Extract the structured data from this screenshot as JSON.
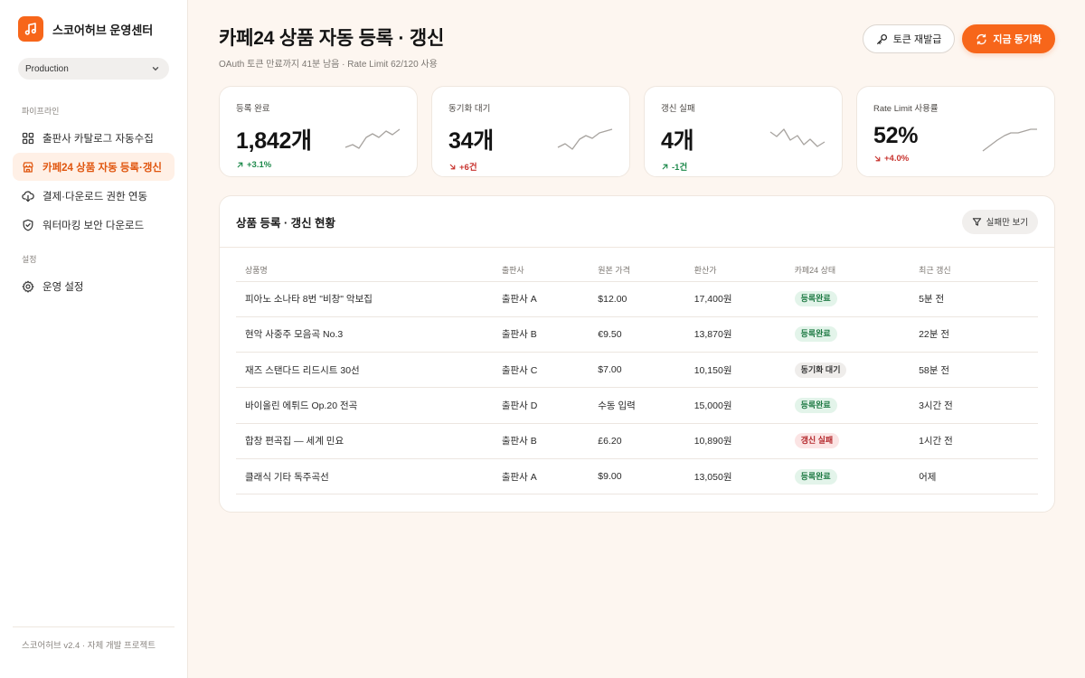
{
  "sidebar": {
    "brand": "스코어허브 운영센터",
    "env": "Production",
    "section_pipeline": "파이프라인",
    "items": [
      {
        "label": "출판사 카탈로그 자동수집",
        "icon": "grid-icon"
      },
      {
        "label": "카페24 상품 자동 등록·갱신",
        "icon": "store-icon",
        "active": true
      },
      {
        "label": "결제·다운로드 권한 연동",
        "icon": "cloud-download-icon"
      },
      {
        "label": "워터마킹 보안 다운로드",
        "icon": "shield-icon"
      }
    ],
    "section_settings": "설정",
    "settings_item": "운영 설정",
    "footer": "스코어허브 v2.4 · 자체 개발 프로젝트"
  },
  "header": {
    "title": "카페24 상품 자동 등록 · 갱신",
    "subtitle": "OAuth 토큰 만료까지 41분 남음 · Rate Limit 62/120 사용",
    "reissue_label": "토큰 재발급",
    "sync_label": "지금 동기화"
  },
  "kpis": [
    {
      "label": "등록 완료",
      "value": "1,842개",
      "delta": "+3.1%",
      "trend": "up",
      "tone": "good"
    },
    {
      "label": "동기화 대기",
      "value": "34개",
      "delta": "+6건",
      "trend": "down",
      "tone": "bad"
    },
    {
      "label": "갱신 실패",
      "value": "4개",
      "delta": "-1건",
      "trend": "up",
      "tone": "good"
    },
    {
      "label": "Rate Limit 사용률",
      "value": "52%",
      "delta": "+4.0%",
      "trend": "down",
      "tone": "bad"
    }
  ],
  "table": {
    "title": "상품 등록 · 갱신 현황",
    "filter_label": "실패만 보기",
    "columns": [
      "상품명",
      "출판사",
      "원본 가격",
      "환산가",
      "카페24 상태",
      "최근 갱신"
    ],
    "rows": [
      {
        "name": "피아노 소나타 8번 \"비창\" 악보집",
        "publisher": "출판사 A",
        "price": "$12.00",
        "converted": "17,400원",
        "status": "등록완료",
        "status_type": "ok",
        "updated": "5분 전"
      },
      {
        "name": "현악 사중주 모음곡 No.3",
        "publisher": "출판사 B",
        "price": "€9.50",
        "converted": "13,870원",
        "status": "등록완료",
        "status_type": "ok",
        "updated": "22분 전"
      },
      {
        "name": "재즈 스탠다드 리드시트 30선",
        "publisher": "출판사 C",
        "price": "$7.00",
        "converted": "10,150원",
        "status": "동기화 대기",
        "status_type": "wait",
        "updated": "58분 전"
      },
      {
        "name": "바이올린 에튀드 Op.20 전곡",
        "publisher": "출판사 D",
        "price": "수동 입력",
        "converted": "15,000원",
        "status": "등록완료",
        "status_type": "ok",
        "updated": "3시간 전"
      },
      {
        "name": "합창 편곡집 — 세계 민요",
        "publisher": "출판사 B",
        "price": "£6.20",
        "converted": "10,890원",
        "status": "갱신 실패",
        "status_type": "fail",
        "updated": "1시간 전"
      },
      {
        "name": "클래식 기타 독주곡선",
        "publisher": "출판사 A",
        "price": "$9.00",
        "converted": "13,050원",
        "status": "등록완료",
        "status_type": "ok",
        "updated": "어제"
      }
    ]
  },
  "colors": {
    "accent": "#f7661a",
    "good": "#1f8a4c",
    "bad": "#c8342f"
  }
}
